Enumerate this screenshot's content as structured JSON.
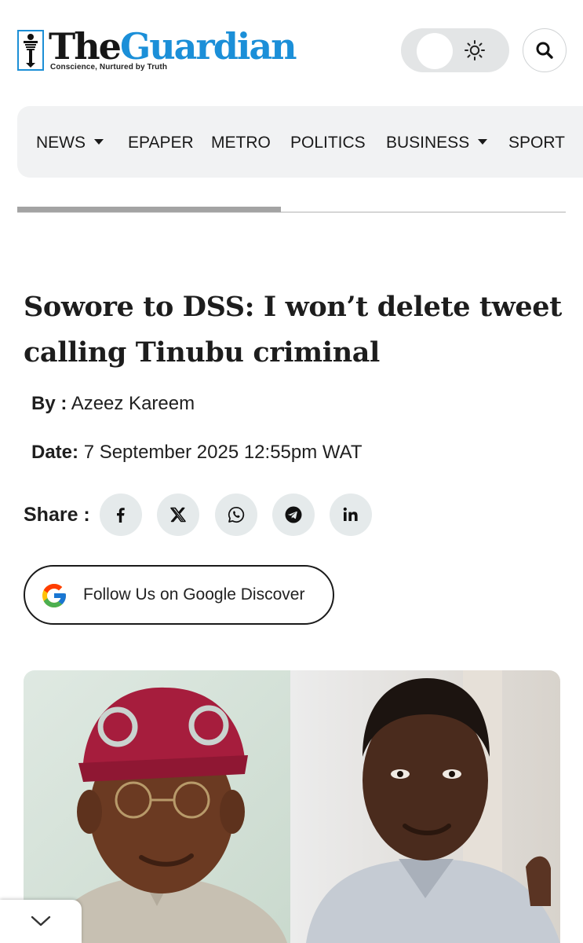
{
  "header": {
    "brand_the": "The",
    "brand_guardian": "Guardian",
    "tagline": "Conscience, Nurtured by Truth",
    "theme_toggle_icon": "sun-icon",
    "search_icon": "search-icon"
  },
  "nav": {
    "items": [
      {
        "label": "NEWS",
        "has_dropdown": true
      },
      {
        "label": "EPAPER",
        "has_dropdown": false
      },
      {
        "label": "METRO",
        "has_dropdown": false
      },
      {
        "label": "POLITICS",
        "has_dropdown": false
      },
      {
        "label": "BUSINESS",
        "has_dropdown": true
      },
      {
        "label": "SPORT",
        "has_dropdown": false
      }
    ]
  },
  "progress": {
    "fraction": 0.48
  },
  "article": {
    "headline": "Sowore to DSS: I won’t delete tweet calling Tinubu criminal",
    "by_label": "By :",
    "author": "Azeez Kareem",
    "date_label": "Date:",
    "date": "7 September 2025 12:55pm WAT",
    "share_label": "Share :",
    "share_buttons": [
      "facebook-icon",
      "x-icon",
      "whatsapp-icon",
      "telegram-icon",
      "linkedin-icon"
    ],
    "google_discover_label": "Follow Us on Google Discover"
  },
  "colors": {
    "brand_blue": "#1b8fd8",
    "nav_bg": "#f1f2f3",
    "share_bg": "#e5eaeb"
  }
}
